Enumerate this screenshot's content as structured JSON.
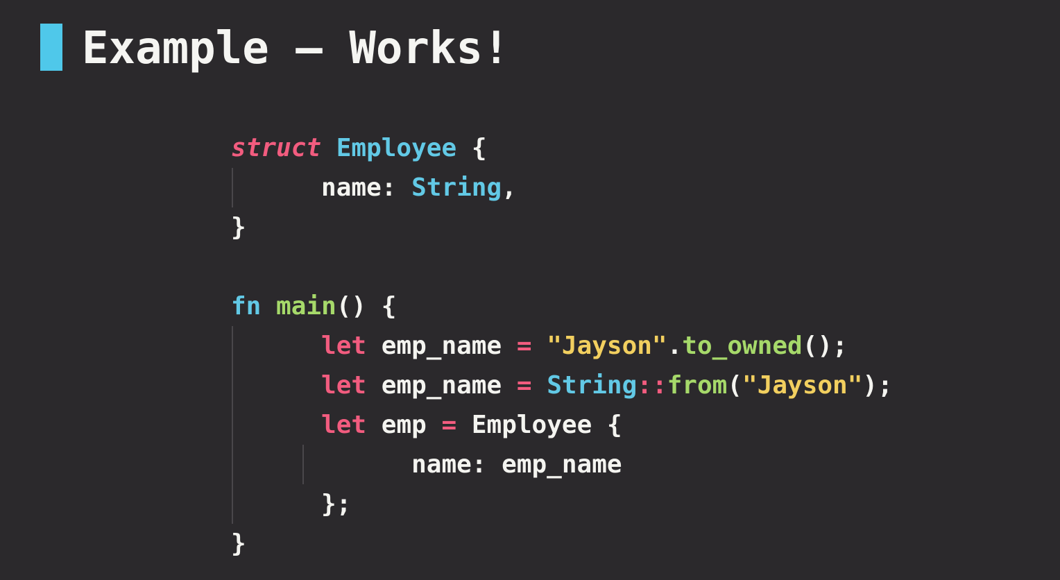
{
  "slide": {
    "title": "Example – Works!"
  },
  "code": {
    "struct_kw": "struct",
    "struct_name": "Employee",
    "open_brace": "{",
    "close_brace": "}",
    "field_name": "name:",
    "field_type": "String",
    "comma": ",",
    "fn_kw": "fn",
    "fn_name": "main",
    "fn_parens": "()",
    "let_kw": "let",
    "var_emp_name": "emp_name",
    "var_emp": "emp",
    "equals": "=",
    "string_literal": "\"Jayson\"",
    "dot": ".",
    "method_to_owned": "to_owned",
    "call_end": "();",
    "type_string": "String",
    "path_sep": "::",
    "method_from": "from",
    "paren_open": "(",
    "paren_close_semi": ");",
    "type_employee": "Employee",
    "struct_close": "};"
  },
  "colors": {
    "background": "#2b292c",
    "accent": "#4fc8ea",
    "keyword": "#f25c7f",
    "type": "#62c9e6",
    "function": "#a6d96a",
    "string": "#f2cf5f",
    "text": "#f4f4f0"
  }
}
